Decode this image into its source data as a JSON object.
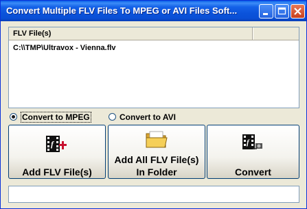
{
  "window": {
    "title": "Convert Multiple FLV Files To MPEG or AVI Files Soft..."
  },
  "titlebar_buttons": [
    "minimize-icon",
    "maximize-icon",
    "close-icon"
  ],
  "file_list": {
    "header": "FLV File(s)",
    "rows": [
      "C:\\\\TMP\\Ultravox - Vienna.flv"
    ]
  },
  "options": {
    "mpeg_label": "Convert to MPEG",
    "avi_label": "Convert to AVI",
    "selected": "mpeg"
  },
  "buttons": {
    "add_files": "Add FLV File(s)",
    "add_folder_line1": "Add All FLV File(s)",
    "add_folder_line2": "In Folder",
    "convert": "Convert"
  },
  "status_bar": {
    "text": ""
  },
  "colors": {
    "titlebar": "#0a5fe8",
    "window_bg": "#ece9d8",
    "list_border": "#7f9db9"
  }
}
